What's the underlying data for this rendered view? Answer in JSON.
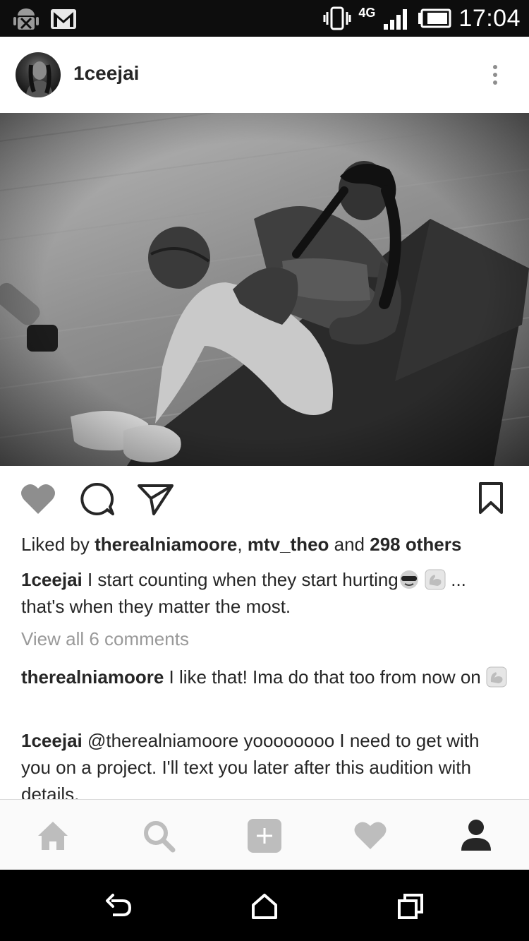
{
  "status_bar": {
    "time": "17:04",
    "network": "4G",
    "icons": [
      "android-debug-icon",
      "gmail-icon",
      "vibrate-icon",
      "signal-icon",
      "battery-icon"
    ]
  },
  "post": {
    "username": "1ceejai",
    "likes": {
      "prefix": "Liked by ",
      "user1": "therealniamoore",
      "separator": ", ",
      "user2": "mtv_theo",
      "middle": " and ",
      "others": "298 others"
    },
    "caption": {
      "user": "1ceejai",
      "text_before": " I start counting when they start hurting",
      "text_after": " ... that's when they matter the most."
    },
    "view_all_comments": "View all 6 comments",
    "comments": [
      {
        "user": "therealniamoore",
        "text": " I like that! Ima do that too from now on "
      },
      {
        "user": "1ceejai",
        "text": " @therealniamoore yoooooooo I need to get with you on a project. I'll text you later after this audition with details."
      }
    ]
  },
  "colors": {
    "text": "#262626",
    "muted": "#999999",
    "icon": "#8e8e8e",
    "statusbar": "#0d0d0d"
  }
}
